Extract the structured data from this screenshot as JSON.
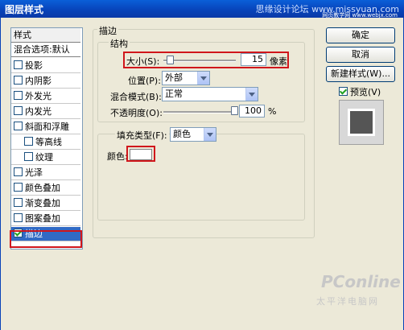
{
  "window": {
    "title": "图层样式",
    "watermark_top": "思缘设计论坛 www.missyuan.com",
    "watermark_top2": "网页教学网 www.webjx.com"
  },
  "style_list": {
    "header": "样式",
    "blend_options": "混合选项:默认",
    "items": [
      {
        "label": "投影",
        "checked": false
      },
      {
        "label": "内阴影",
        "checked": false
      },
      {
        "label": "外发光",
        "checked": false
      },
      {
        "label": "内发光",
        "checked": false
      },
      {
        "label": "斜面和浮雕",
        "checked": false
      },
      {
        "label": "等高线",
        "checked": false
      },
      {
        "label": "纹理",
        "checked": false
      },
      {
        "label": "光泽",
        "checked": false
      },
      {
        "label": "颜色叠加",
        "checked": false
      },
      {
        "label": "渐变叠加",
        "checked": false
      },
      {
        "label": "图案叠加",
        "checked": false
      },
      {
        "label": "描边",
        "checked": true
      }
    ]
  },
  "stroke": {
    "group_title": "描边",
    "structure_title": "结构",
    "size_label": "大小(S):",
    "size_value": "15",
    "size_unit": "像素",
    "position_label": "位置(P):",
    "position_value": "外部",
    "blend_mode_label": "混合模式(B):",
    "blend_mode_value": "正常",
    "opacity_label": "不透明度(O):",
    "opacity_value": "100",
    "opacity_unit": "%",
    "fill_type_label": "填充类型(F):",
    "fill_type_value": "颜色",
    "color_label": "颜色:",
    "color_value": "#ffffff"
  },
  "buttons": {
    "ok": "确定",
    "cancel": "取消",
    "new_style": "新建样式(W)...",
    "preview_label": "预览(V)",
    "preview_checked": true
  },
  "watermark": {
    "brand": "PConline",
    "sub": "太平洋电脑网"
  }
}
